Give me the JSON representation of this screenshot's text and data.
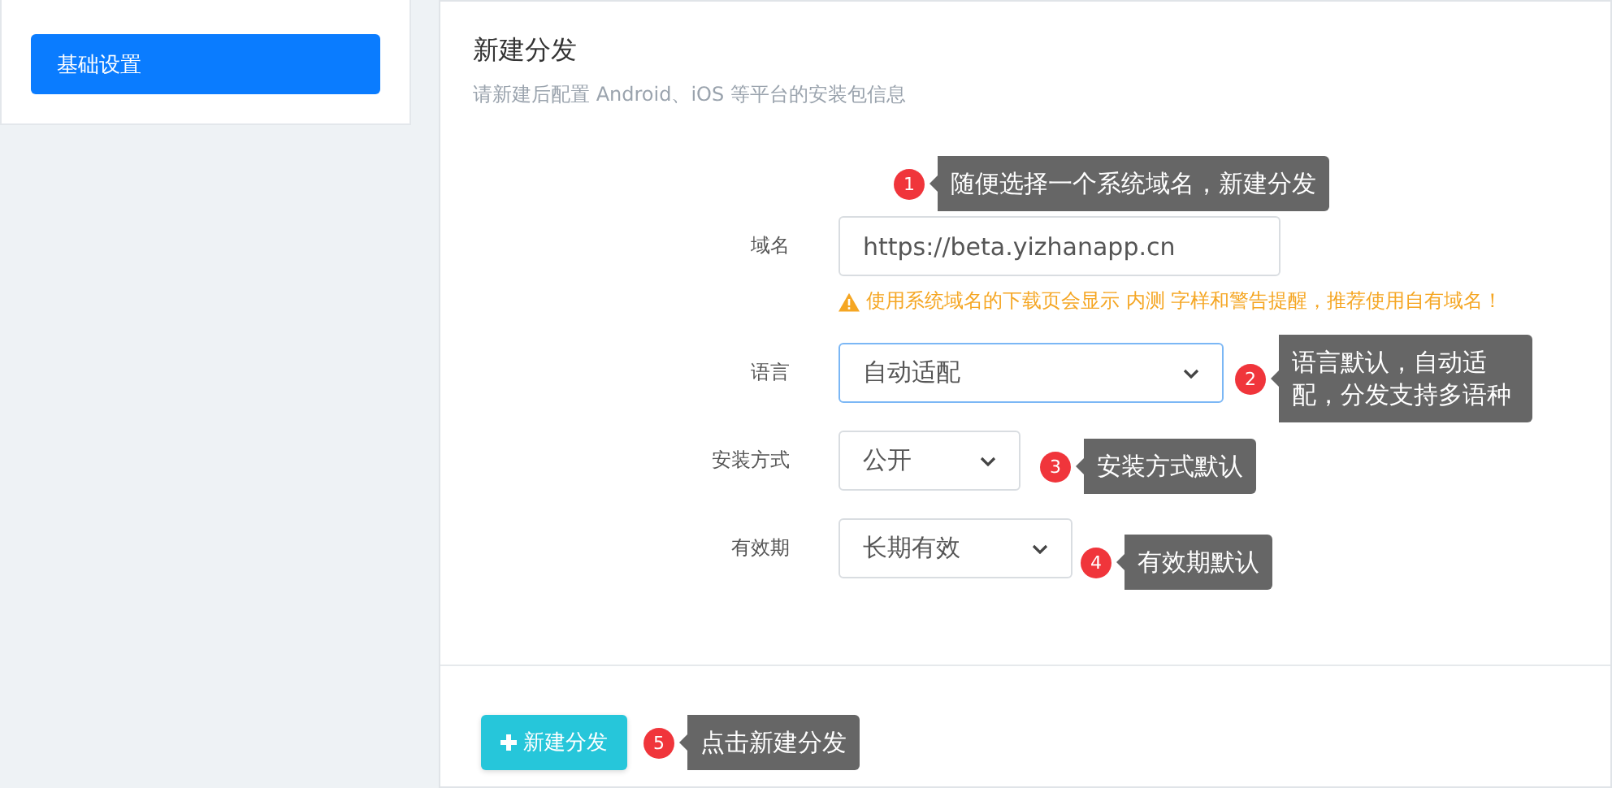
{
  "sidebar": {
    "items": [
      {
        "label": "基础设置",
        "selected": true
      }
    ]
  },
  "panel": {
    "title": "新建分发",
    "subtitle": "请新建后配置 Android、iOS 等平台的安装包信息"
  },
  "form": [
    {
      "label": "域名",
      "kind": "input",
      "value": "https://beta.yizhanapp.cn",
      "focused": false,
      "warning": "使用系统域名的下载页会显示 内测 字样和警告提醒，推荐使用自有域名！",
      "hint_number": "1",
      "hint": "随便选择一个系统域名，新建分发"
    },
    {
      "label": "语言",
      "kind": "select",
      "value": "自动适配",
      "focused": true,
      "hint_number": "2",
      "hint": "语言默认，自动适配，分发支持多语种"
    },
    {
      "label": "安装方式",
      "kind": "select",
      "value": "公开",
      "focused": false,
      "hint_number": "3",
      "hint": "安装方式默认"
    },
    {
      "label": "有效期",
      "kind": "select",
      "value": "长期有效",
      "focused": false,
      "hint_number": "4",
      "hint": "有效期默认"
    }
  ],
  "submit": {
    "label": "新建分发",
    "hint_number": "5",
    "hint": "点击新建分发"
  }
}
